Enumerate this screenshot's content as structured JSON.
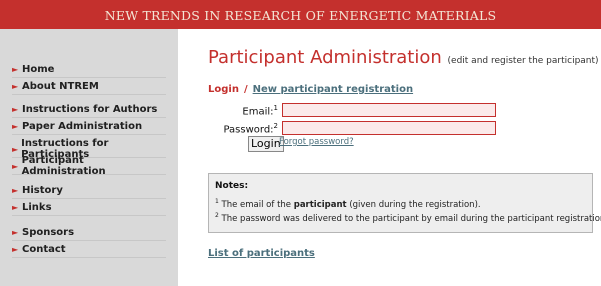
{
  "header": {
    "banner_title": "NEW TRENDS IN RESEARCH OF ENERGETIC MATERIALS"
  },
  "colors": {
    "banner": "#c4302d",
    "sidebar": "#d9d9d9",
    "accent_red": "#c4302d",
    "link": "#4b6f7c"
  },
  "sidebar": {
    "groups": [
      [
        {
          "label": "Home"
        },
        {
          "label": "About NTREM"
        }
      ],
      [
        {
          "label": "Instructions for Authors"
        },
        {
          "label": "Paper Administration"
        }
      ],
      [
        {
          "label": "Instructions for Participants"
        },
        {
          "label": "Participant Administration"
        }
      ],
      [
        {
          "label": "History"
        },
        {
          "label": "Links"
        }
      ],
      [
        {
          "label": "Sponsors"
        },
        {
          "label": "Contact"
        }
      ]
    ],
    "arrow_icon": "chevron-right-icon",
    "arrow_glyph": "►"
  },
  "main": {
    "title": "Participant Administration",
    "subtitle": "(edit and register the participant)",
    "tabs": {
      "login": "Login",
      "separator": "/",
      "new_registration": "New participant registration"
    },
    "form": {
      "email_label": "Email:",
      "email_sup": "1",
      "password_label": "Password:",
      "password_sup": "2",
      "email_value": "",
      "password_value": "",
      "login_button": "Login",
      "forgot_link": "Forgot password?"
    },
    "notes": {
      "title": "Notes:",
      "note1_sup": "1",
      "note1_pre": "The email of the ",
      "note1_bold": "participant",
      "note1_post": " (given during the registration).",
      "note2_sup": "2",
      "note2_text": "The password was delivered to the participant by email during the participant registration."
    },
    "list_link": "List of participants"
  }
}
